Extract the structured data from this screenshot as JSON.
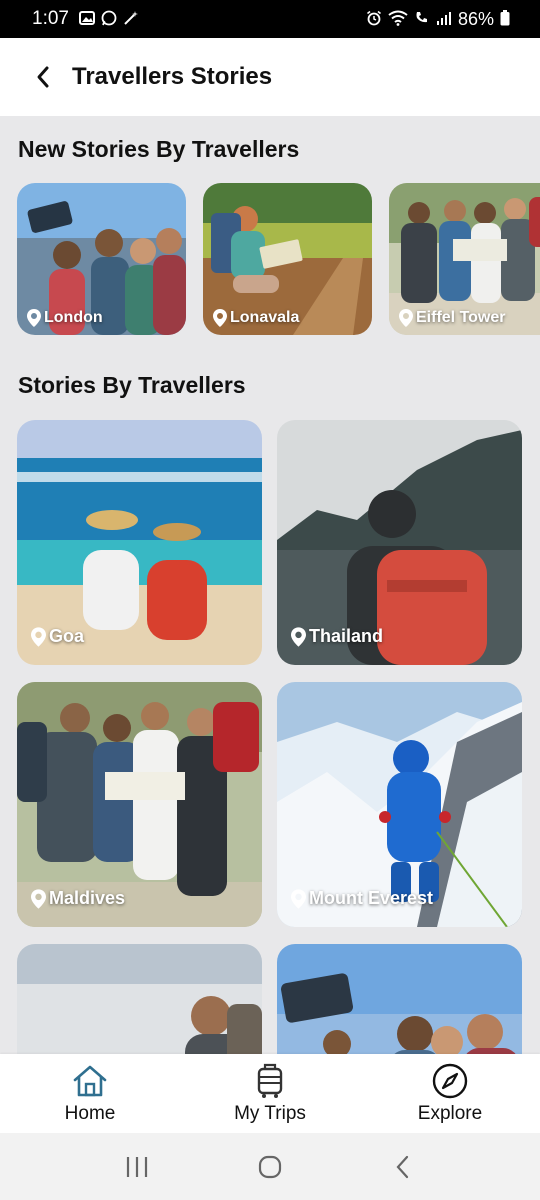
{
  "status_bar": {
    "time": "1:07",
    "battery": "86%"
  },
  "header": {
    "title": "Travellers Stories"
  },
  "sections": {
    "new_stories": {
      "title": "New Stories By Travellers"
    },
    "stories": {
      "title": "Stories By Travellers"
    }
  },
  "new_stories": [
    {
      "location": "London"
    },
    {
      "location": "Lonavala"
    },
    {
      "location": "Eiffel Tower"
    }
  ],
  "stories": [
    {
      "location": "Goa"
    },
    {
      "location": "Thailand"
    },
    {
      "location": "Maldives"
    },
    {
      "location": "Mount Everest"
    },
    {
      "location": ""
    },
    {
      "location": ""
    }
  ],
  "bottom_nav": [
    {
      "label": "Home",
      "icon": "home-icon",
      "active": true
    },
    {
      "label": "My Trips",
      "icon": "luggage-icon"
    },
    {
      "label": "Explore",
      "icon": "compass-icon"
    }
  ],
  "colors": {
    "accent": "#2f6f8f",
    "background": "#e8e8ea"
  }
}
